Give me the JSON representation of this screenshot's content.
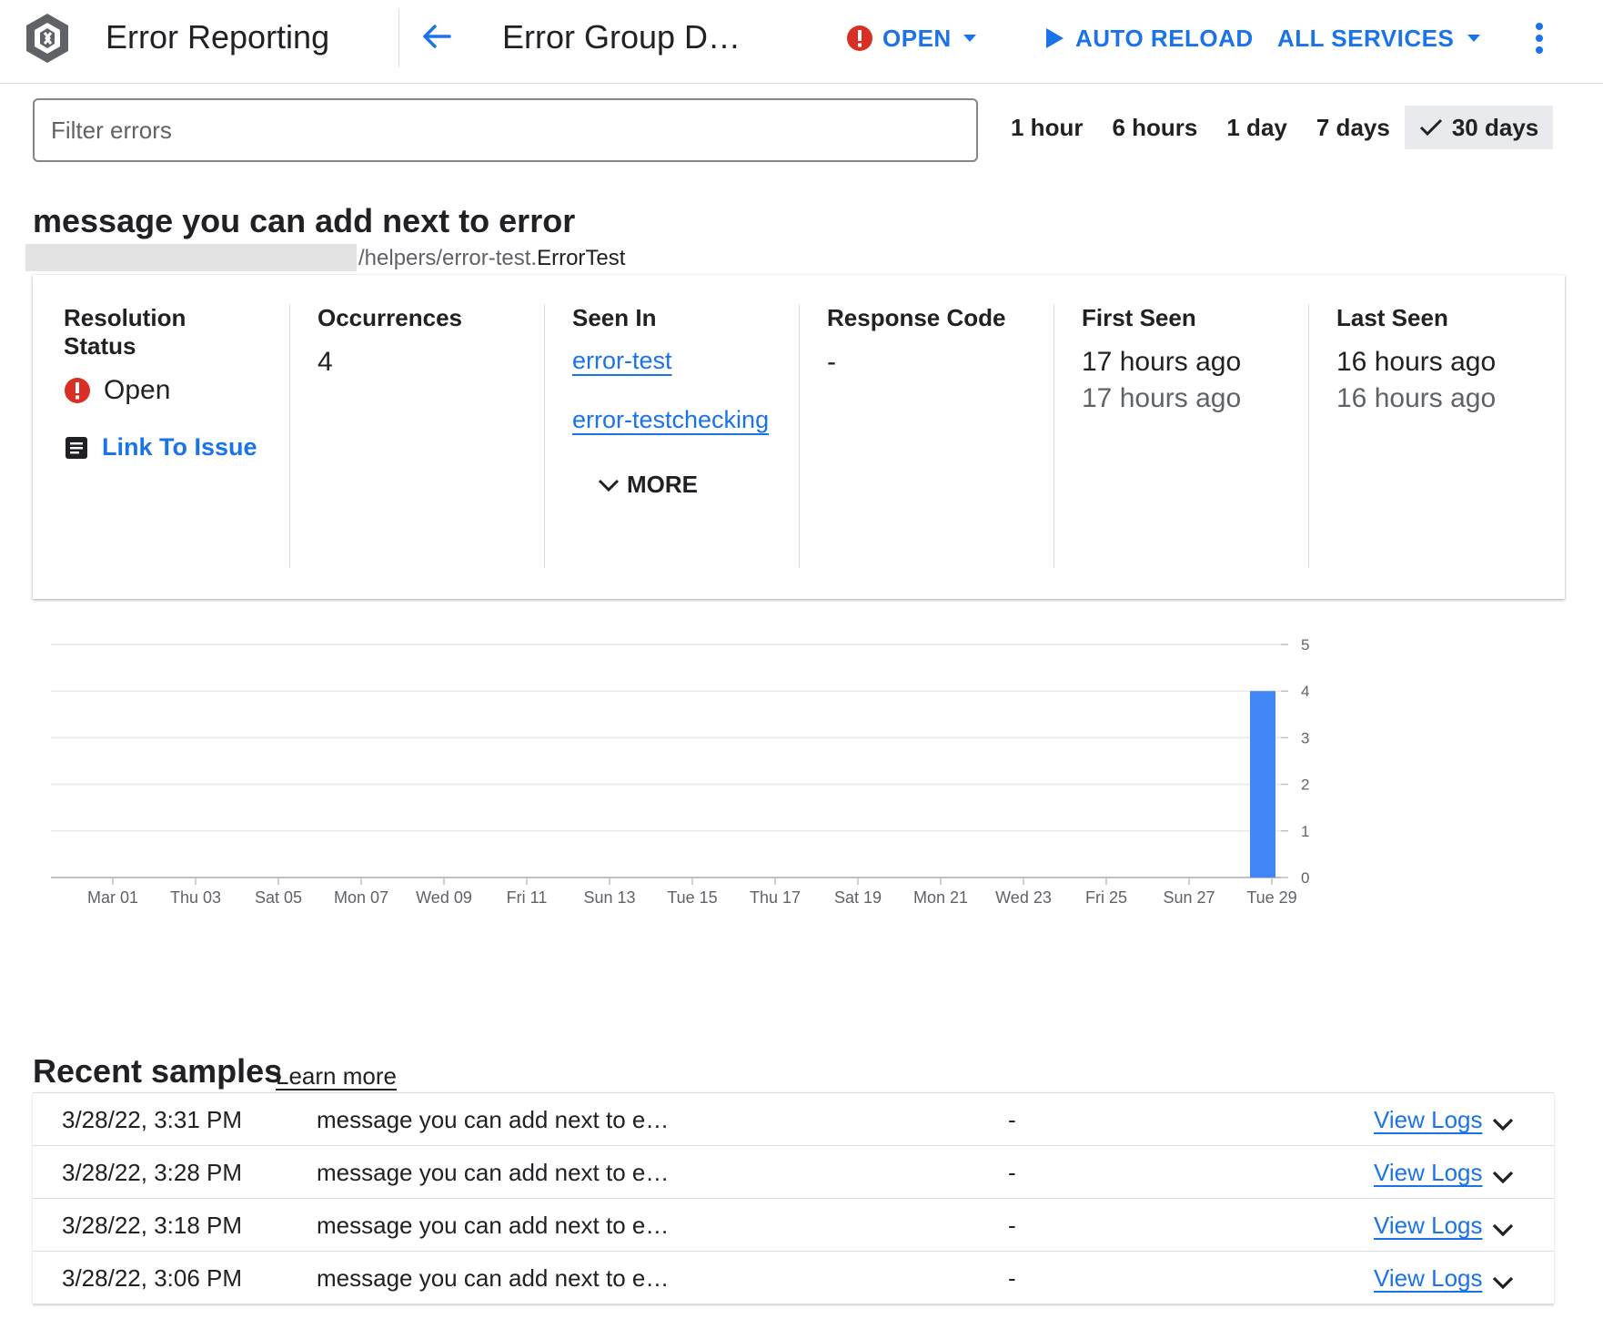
{
  "app": {
    "title": "Error Reporting"
  },
  "header": {
    "page_title": "Error Group D…",
    "status_label": "OPEN",
    "auto_reload_label": "AUTO RELOAD",
    "services_label": "ALL SERVICES"
  },
  "filter": {
    "placeholder": "Filter errors",
    "value": ""
  },
  "time_range": {
    "options": [
      "1 hour",
      "6 hours",
      "1 day",
      "7 days",
      "30 days"
    ],
    "selected": "30 days"
  },
  "error": {
    "message": "message you can add next to error",
    "path": "/helpers/error-test.",
    "class_name": "ErrorTest"
  },
  "details": {
    "resolution_status": {
      "header": "Resolution Status",
      "value": "Open",
      "link_label": "Link To Issue"
    },
    "occurrences": {
      "header": "Occurrences",
      "value": "4"
    },
    "seen_in": {
      "header": "Seen In",
      "services": [
        "error-test",
        "error-testchecking"
      ],
      "more_label": "MORE"
    },
    "response_code": {
      "header": "Response Code",
      "value": "-"
    },
    "first_seen": {
      "header": "First Seen",
      "value": "17 hours ago",
      "secondary": "17 hours ago"
    },
    "last_seen": {
      "header": "Last Seen",
      "value": "16 hours ago",
      "secondary": "16 hours ago"
    }
  },
  "chart_data": {
    "type": "bar",
    "x_tick_labels": [
      "Mar 01",
      "Thu 03",
      "Sat 05",
      "Mon 07",
      "Wed 09",
      "Fri 11",
      "Sun 13",
      "Tue 15",
      "Thu 17",
      "Sat 19",
      "Mon 21",
      "Wed 23",
      "Fri 25",
      "Sun 27",
      "Tue 29"
    ],
    "categories": [
      "Mar 01",
      "Thu 03",
      "Sat 05",
      "Mon 07",
      "Wed 09",
      "Fri 11",
      "Sun 13",
      "Tue 15",
      "Thu 17",
      "Sat 19",
      "Mon 21",
      "Wed 23",
      "Fri 25",
      "Sun 27",
      "Tue 29"
    ],
    "values": [
      0,
      0,
      0,
      0,
      0,
      0,
      0,
      0,
      0,
      0,
      0,
      0,
      0,
      0,
      4
    ],
    "y_ticks": [
      0,
      1,
      2,
      3,
      4,
      5
    ],
    "ylim": [
      0,
      5
    ],
    "y_axis_side": "right",
    "grid": true,
    "bar_color": "#4285f4"
  },
  "samples": {
    "title": "Recent samples",
    "learn_more": "Learn more",
    "rows": [
      {
        "time": "3/28/22, 3:31 PM",
        "message": "message you can add next to e…",
        "code": "-",
        "logs": "View Logs"
      },
      {
        "time": "3/28/22, 3:28 PM",
        "message": "message you can add next to e…",
        "code": "-",
        "logs": "View Logs"
      },
      {
        "time": "3/28/22, 3:18 PM",
        "message": "message you can add next to e…",
        "code": "-",
        "logs": "View Logs"
      },
      {
        "time": "3/28/22, 3:06 PM",
        "message": "message you can add next to e…",
        "code": "-",
        "logs": "View Logs"
      }
    ]
  },
  "colors": {
    "accent": "#1a73e8",
    "error_red": "#d93025",
    "bar": "#4285f4"
  }
}
